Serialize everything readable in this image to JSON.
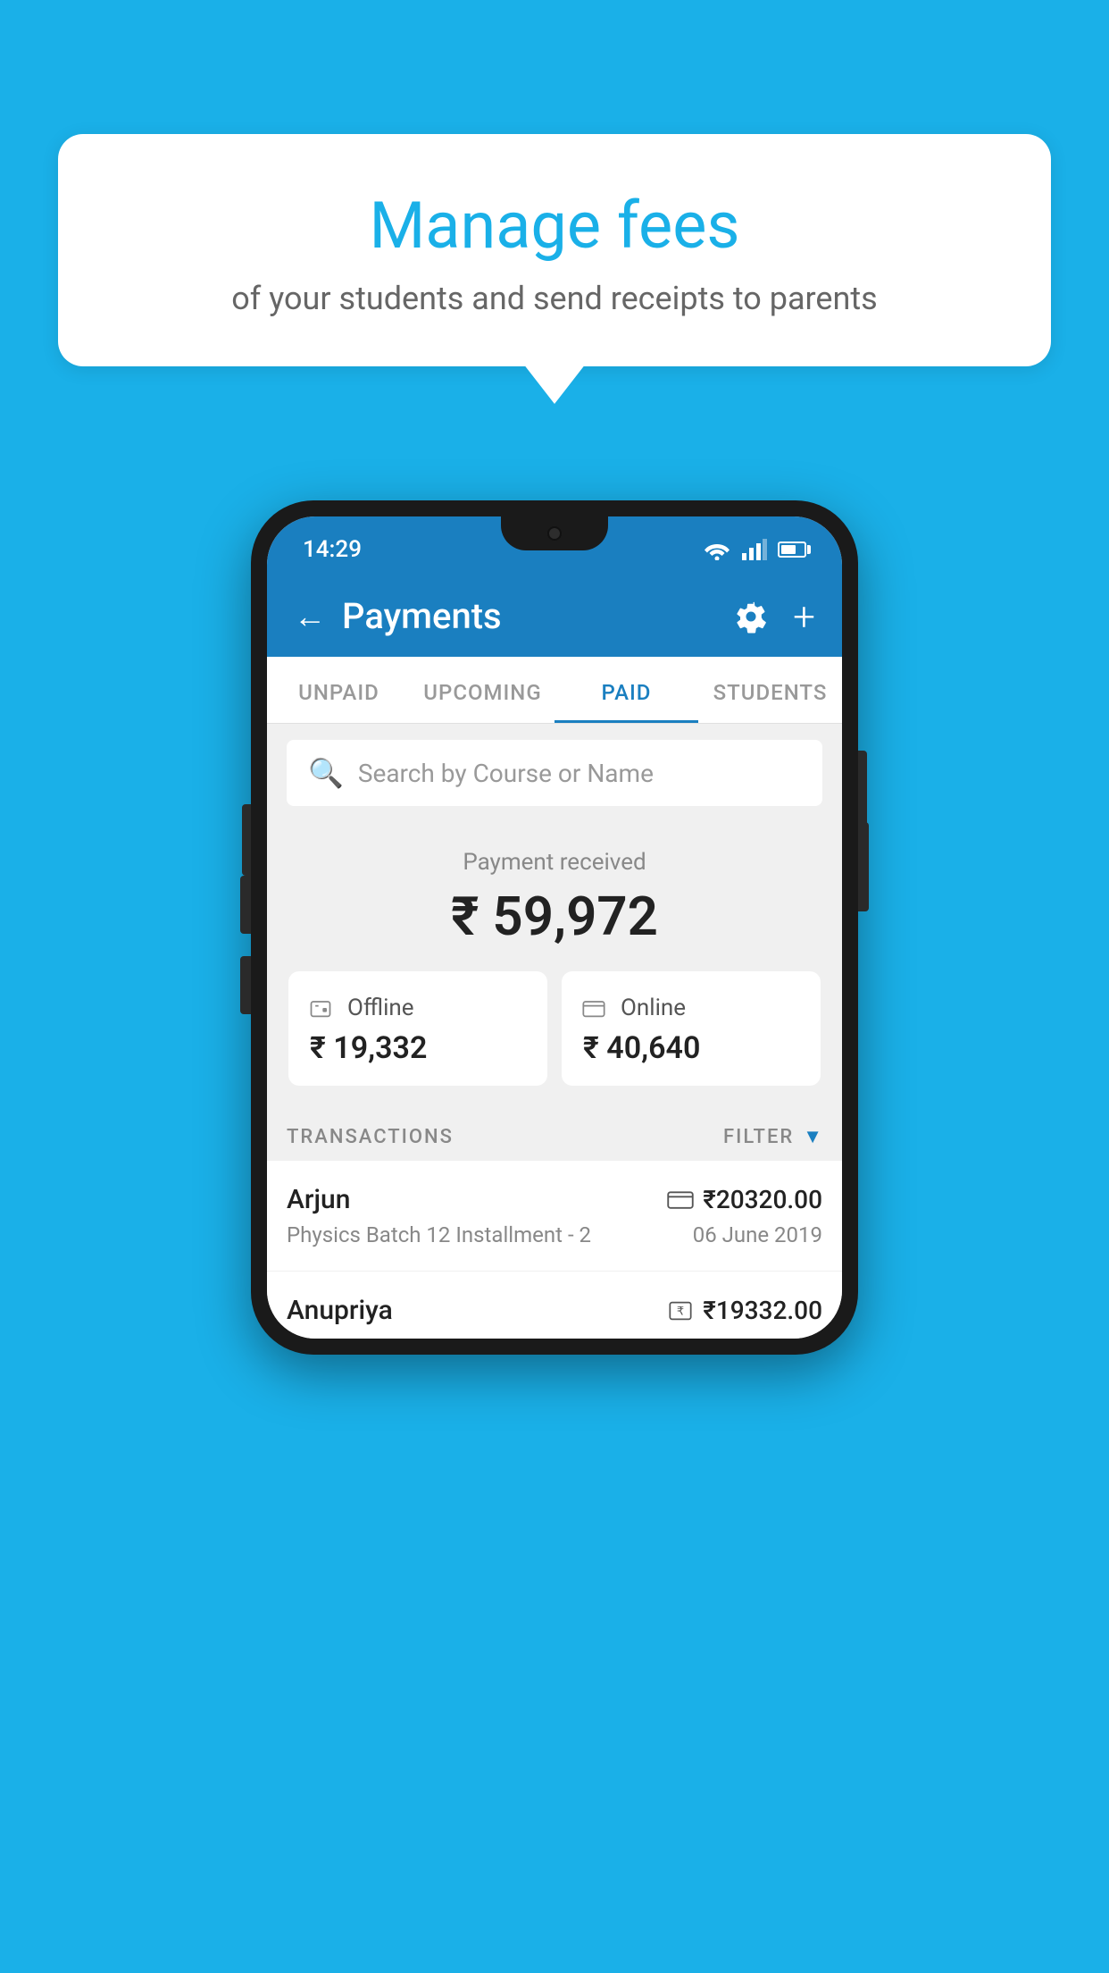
{
  "background_color": "#1ab0e8",
  "bubble": {
    "title": "Manage fees",
    "subtitle": "of your students and send receipts to parents"
  },
  "status_bar": {
    "time": "14:29"
  },
  "header": {
    "title": "Payments",
    "back_label": "←",
    "plus_label": "+"
  },
  "tabs": [
    {
      "label": "UNPAID",
      "active": false
    },
    {
      "label": "UPCOMING",
      "active": false
    },
    {
      "label": "PAID",
      "active": true
    },
    {
      "label": "STUDENTS",
      "active": false
    }
  ],
  "search": {
    "placeholder": "Search by Course or Name"
  },
  "payment_summary": {
    "label": "Payment received",
    "amount": "₹ 59,972",
    "offline_label": "Offline",
    "offline_amount": "₹ 19,332",
    "online_label": "Online",
    "online_amount": "₹ 40,640"
  },
  "transactions": {
    "section_label": "TRANSACTIONS",
    "filter_label": "FILTER",
    "rows": [
      {
        "name": "Arjun",
        "amount": "₹20320.00",
        "course": "Physics Batch 12 Installment - 2",
        "date": "06 June 2019",
        "payment_mode": "online"
      },
      {
        "name": "Anupriya",
        "amount": "₹19332.00",
        "course": "",
        "date": "",
        "payment_mode": "offline"
      }
    ]
  }
}
